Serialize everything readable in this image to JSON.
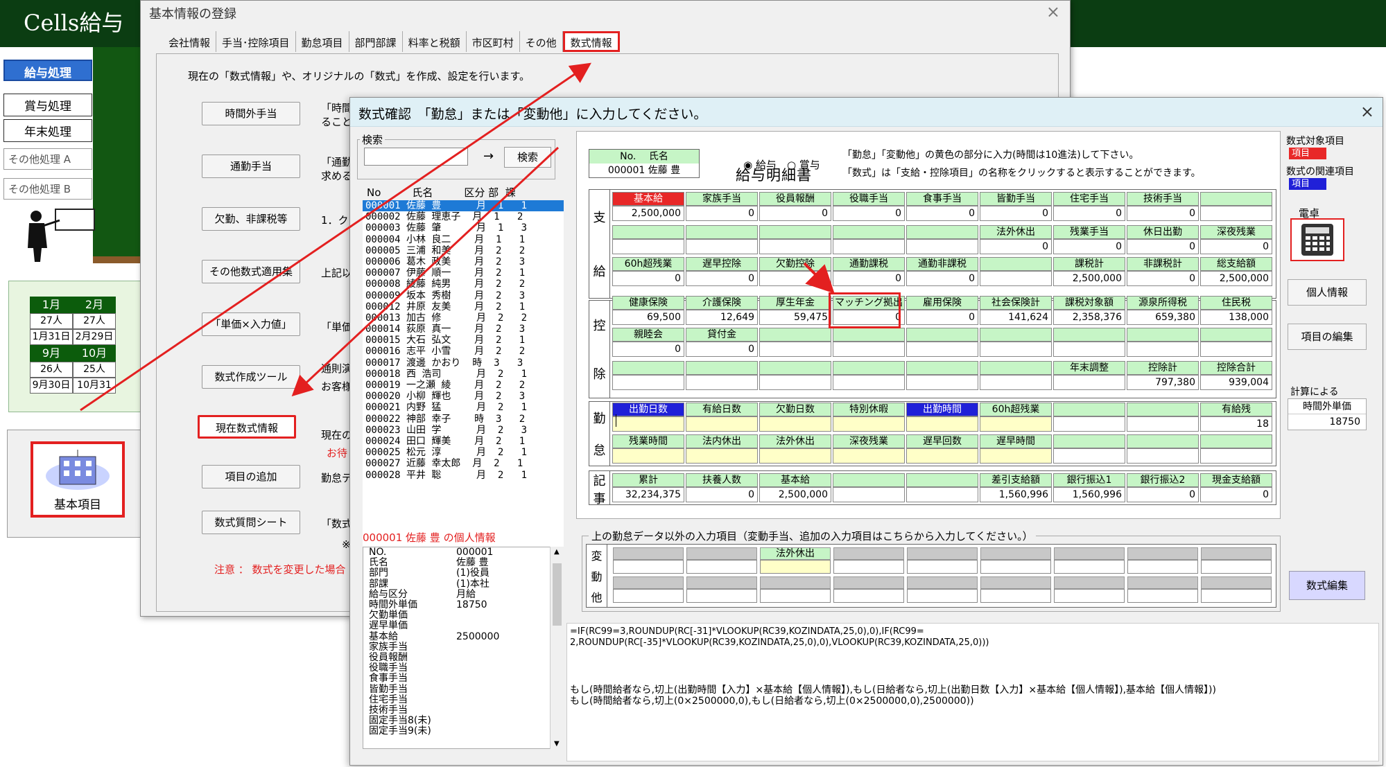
{
  "app": {
    "title": "Cells給与",
    "side": {
      "kyuyo": "給与処理",
      "shoyo": "賞与処理",
      "nenmatsu": "年末処理",
      "other_a": "その他処理 A",
      "other_b": "その他処理 B"
    },
    "calendar": {
      "months": [
        "1月",
        "2月",
        "9月",
        "10月"
      ],
      "counts": [
        "27人",
        "27人",
        "26人",
        "25人"
      ],
      "dates": [
        "1月31日",
        "2月29日",
        "9月30日",
        "10月31"
      ]
    },
    "kihon_label": "基本項目"
  },
  "dialog1": {
    "title": "基本情報の登録",
    "close": "×",
    "tabs": [
      "会社情報",
      "手当･控除項目",
      "勤怠項目",
      "部門部課",
      "料率と税額",
      "市区町村",
      "その他",
      "数式情報"
    ],
    "description": "現在の「数式情報」や、オリジナルの「数式」を作成、設定を行います。",
    "buttons": [
      "時間外手当",
      "通勤手当",
      "欠勤、非課税等",
      "その他数式適用集",
      "「単価×入力値」",
      "数式作成ツール",
      "現在数式情報",
      "項目の追加",
      "数式質問シート"
    ],
    "texts": [
      "「時間",
      "「通勤",
      "1．ク",
      "上記以",
      "「単価",
      "通則演",
      "現在の",
      "勤怠デ",
      "「数式"
    ],
    "extra_texts": [
      "ることが",
      "求める",
      "お客様",
      "お待",
      "※"
    ],
    "note": "注意 ： 数式を変更した場合"
  },
  "dialog2": {
    "title": "数式確認　「勤怠」または「変動他」に入力してください。",
    "close": "×",
    "search": {
      "legend": "検索",
      "arrow": "→",
      "button": "検索",
      "value": ""
    },
    "list_header": "No　　　氏名　　　区分 部  課",
    "employees": [
      "000001 佐藤 豊      月  1   1",
      "000002 佐藤 理恵子  月  1   2",
      "000003 佐藤 肇      月  1   3",
      "000004 小林 良二    月  1   1",
      "000005 三浦 和美    月  2   2",
      "000006 葛木 政美    月  2   3",
      "000007 伊藤 順一    月  2   1",
      "000008 綾藤 純男    月  2   2",
      "000009 坂本 秀樹    月  2   3",
      "000012 井原 友美    月  2   1",
      "000013 加古 修      月  2   2",
      "000014 荻原 真一    月  2   3",
      "000015 大石 弘文    月  2   1",
      "000016 志平 小雪    月  2   2",
      "000017 渡邊 かおり  時  3   3",
      "000018 西 浩司      月  2   1",
      "000019 一之瀬 綾    月  2   2",
      "000020 小柳 輝也    月  2   3",
      "000021 内野 猛      月  2   1",
      "000022 神部 幸子    時  3   2",
      "000023 山田 学      月  2   3",
      "000024 田口 輝美    月  2   1",
      "000025 松元 淳      月  2   1",
      "000027 近藤 幸太郎  月  2   1",
      "000028 平井 聡      月  2   1"
    ],
    "info_title": "000001 佐藤 豊 の個人情報",
    "info": [
      [
        "NO.",
        "000001"
      ],
      [
        "氏名",
        "佐藤 豊"
      ],
      [
        "部門",
        "(1)役員"
      ],
      [
        "部課",
        "(1)本社"
      ],
      [
        "給与区分",
        "月給"
      ],
      [
        "時間外単価",
        "18750"
      ],
      [
        "欠勤単価",
        ""
      ],
      [
        "遅早単価",
        ""
      ],
      [
        "基本給",
        "2500000"
      ],
      [
        "家族手当",
        ""
      ],
      [
        "役員報酬",
        ""
      ],
      [
        "役職手当",
        ""
      ],
      [
        "食事手当",
        ""
      ],
      [
        "皆勤手当",
        ""
      ],
      [
        "住宅手当",
        ""
      ],
      [
        "技術手当",
        ""
      ],
      [
        "固定手当8(未)",
        ""
      ],
      [
        "固定手当9(未)",
        ""
      ]
    ],
    "payslip": {
      "no_header": "No.　 氏名",
      "no_value": "000001 佐藤 豊",
      "radio_kyuyo": "◉ 給与",
      "radio_shoyo": "○ 賞与",
      "heading": "給与明細書",
      "note1": "「勤怠」「変動他」の黄色の部分に入力(時間は10進法)して下さい。",
      "note2": "「数式」は「支給・控除項目」の名称をクリックすると表示することができます。",
      "shikyu_label": [
        "支",
        "給"
      ],
      "koujo_label": [
        "控",
        "除"
      ],
      "kintai_label": [
        "勤",
        "怠"
      ],
      "kiji_label": [
        "記",
        "事"
      ],
      "shikyu_rows": [
        {
          "h": [
            "基本給",
            "家族手当",
            "役員報酬",
            "役職手当",
            "食事手当",
            "皆勤手当",
            "住宅手当",
            "技術手当",
            ""
          ],
          "v": [
            "2,500,000",
            "0",
            "0",
            "0",
            "0",
            "0",
            "0",
            "0",
            ""
          ]
        },
        {
          "h": [
            "",
            "",
            "",
            "",
            "",
            "法外休出",
            "残業手当",
            "休日出勤",
            "深夜残業"
          ],
          "v": [
            "",
            "",
            "",
            "",
            "",
            "0",
            "0",
            "0",
            "0"
          ]
        },
        {
          "h": [
            "60h超残業",
            "遅早控除",
            "欠勤控除",
            "通勤課税",
            "通勤非課税",
            "",
            "課税計",
            "非課税計",
            "総支給額"
          ],
          "v": [
            "0",
            "0",
            "0",
            "0",
            "0",
            "",
            "2,500,000",
            "0",
            "2,500,000"
          ]
        }
      ],
      "koujo_rows": [
        {
          "h": [
            "健康保険",
            "介護保険",
            "厚生年金",
            "マッチング拠出",
            "雇用保険",
            "社会保険計",
            "課税対象額",
            "源泉所得税",
            "住民税"
          ],
          "v": [
            "69,500",
            "12,649",
            "59,475",
            "0",
            "0",
            "141,624",
            "2,358,376",
            "659,380",
            "138,000"
          ]
        },
        {
          "h": [
            "親睦会",
            "貸付金",
            "",
            "",
            "",
            "",
            "",
            "",
            ""
          ],
          "v": [
            "0",
            "0",
            "",
            "",
            "",
            "",
            "",
            "",
            ""
          ]
        },
        {
          "h": [
            "",
            "",
            "",
            "",
            "",
            "",
            "年末調整",
            "控除計",
            "控除合計"
          ],
          "v": [
            "",
            "",
            "",
            "",
            "",
            "",
            "",
            "797,380",
            "939,004"
          ]
        }
      ],
      "kintai_rows": [
        {
          "h": [
            "出勤日数",
            "有給日数",
            "欠勤日数",
            "特別休暇",
            "出勤時間",
            "60h超残業",
            "",
            "",
            "有給残"
          ],
          "v": [
            "",
            "",
            "",
            "",
            "",
            "",
            "",
            "",
            "18"
          ]
        },
        {
          "h": [
            "残業時間",
            "法内休出",
            "法外休出",
            "深夜残業",
            "遅早回数",
            "遅早時間",
            "",
            "",
            ""
          ],
          "v": [
            "",
            "",
            "",
            "",
            "",
            "",
            "",
            "",
            ""
          ]
        }
      ],
      "kiji_row": {
        "h": [
          "累計",
          "扶養人数",
          "基本給",
          "",
          "",
          "差引支給額",
          "銀行振込1",
          "銀行振込2",
          "現金支給額"
        ],
        "v": [
          "32,234,375",
          "0",
          "2,500,000",
          "",
          "",
          "1,560,996",
          "1,560,996",
          "0",
          "0"
        ]
      }
    },
    "right": {
      "target_label": "数式対象項目",
      "target_tag": "項目",
      "related_label": "数式の関連項目",
      "related_tag": "項目",
      "calc_label": "電卓",
      "personal_btn": "個人情報",
      "edit_items_btn": "項目の編集",
      "calc_by": "計算による",
      "unit_head": "時間外単価",
      "unit_val": "18750",
      "formula_edit_btn": "数式編集"
    },
    "other": {
      "legend": "上の勤怠データ以外の入力項目（変動手当、追加の入力項目はこちらから入力してください。）",
      "label": [
        "変",
        "動",
        "他"
      ],
      "cell": "法外休出"
    },
    "formula1": "=IF(RC99=3,ROUNDUP(RC[-31]*VLOOKUP(RC39,KOZINDATA,25,0),0),IF(RC99=\n2,ROUNDUP(RC[-35]*VLOOKUP(RC39,KOZINDATA,25,0),0),VLOOKUP(RC39,KOZINDATA,25,0)))",
    "formula2": "もし(時間給者なら,切上(出勤時間【入力】×基本給【個人情報】),もし(日給者なら,切上(出勤日数【入力】×基本給【個人情報】),基本給【個人情報】))\nもし(時間給者なら,切上(0×2500000,0),もし(日給者なら,切上(0×2500000,0),2500000))"
  },
  "colors": {
    "highlight": "#e32020",
    "header_green": "#c6f5c6",
    "input_yellow": "#ffffc8",
    "app_bar": "#0b3d12"
  }
}
